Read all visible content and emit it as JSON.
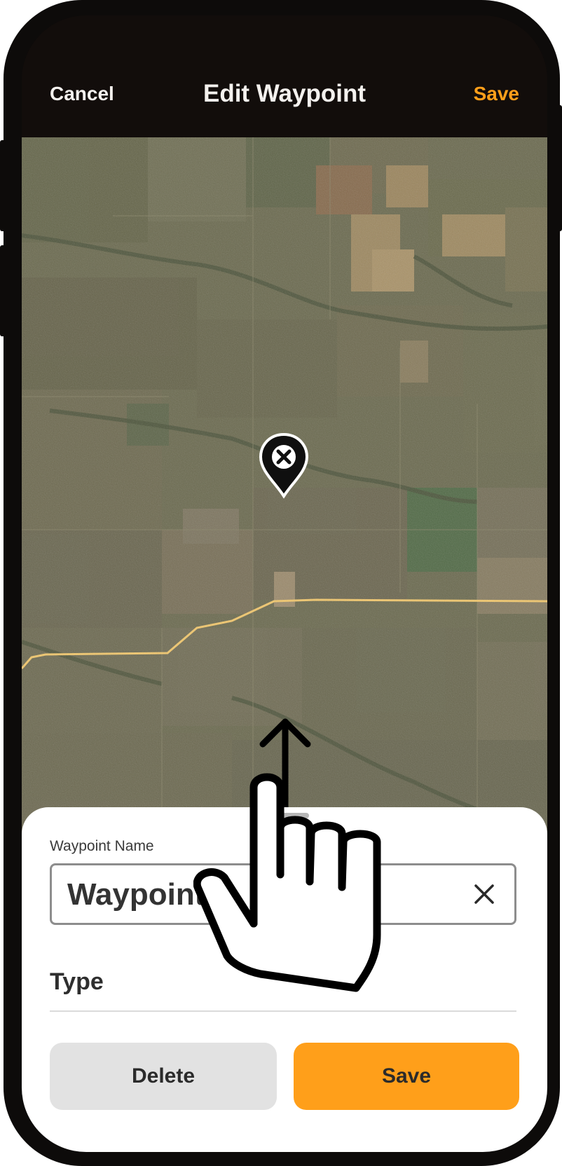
{
  "header": {
    "cancel_label": "Cancel",
    "title": "Edit Waypoint",
    "save_label": "Save"
  },
  "map": {
    "marker_icon": "close-marker-icon",
    "road_color": "#f2c76b"
  },
  "gesture": {
    "icon": "swipe-up-hand-icon"
  },
  "sheet": {
    "name_label": "Waypoint Name",
    "name_value": "Waypoint",
    "type_label": "Type",
    "delete_label": "Delete",
    "save_label": "Save"
  },
  "colors": {
    "accent": "#ff9f1a",
    "header_bg": "#120d0b",
    "delete_bg": "#e2e2e2"
  }
}
